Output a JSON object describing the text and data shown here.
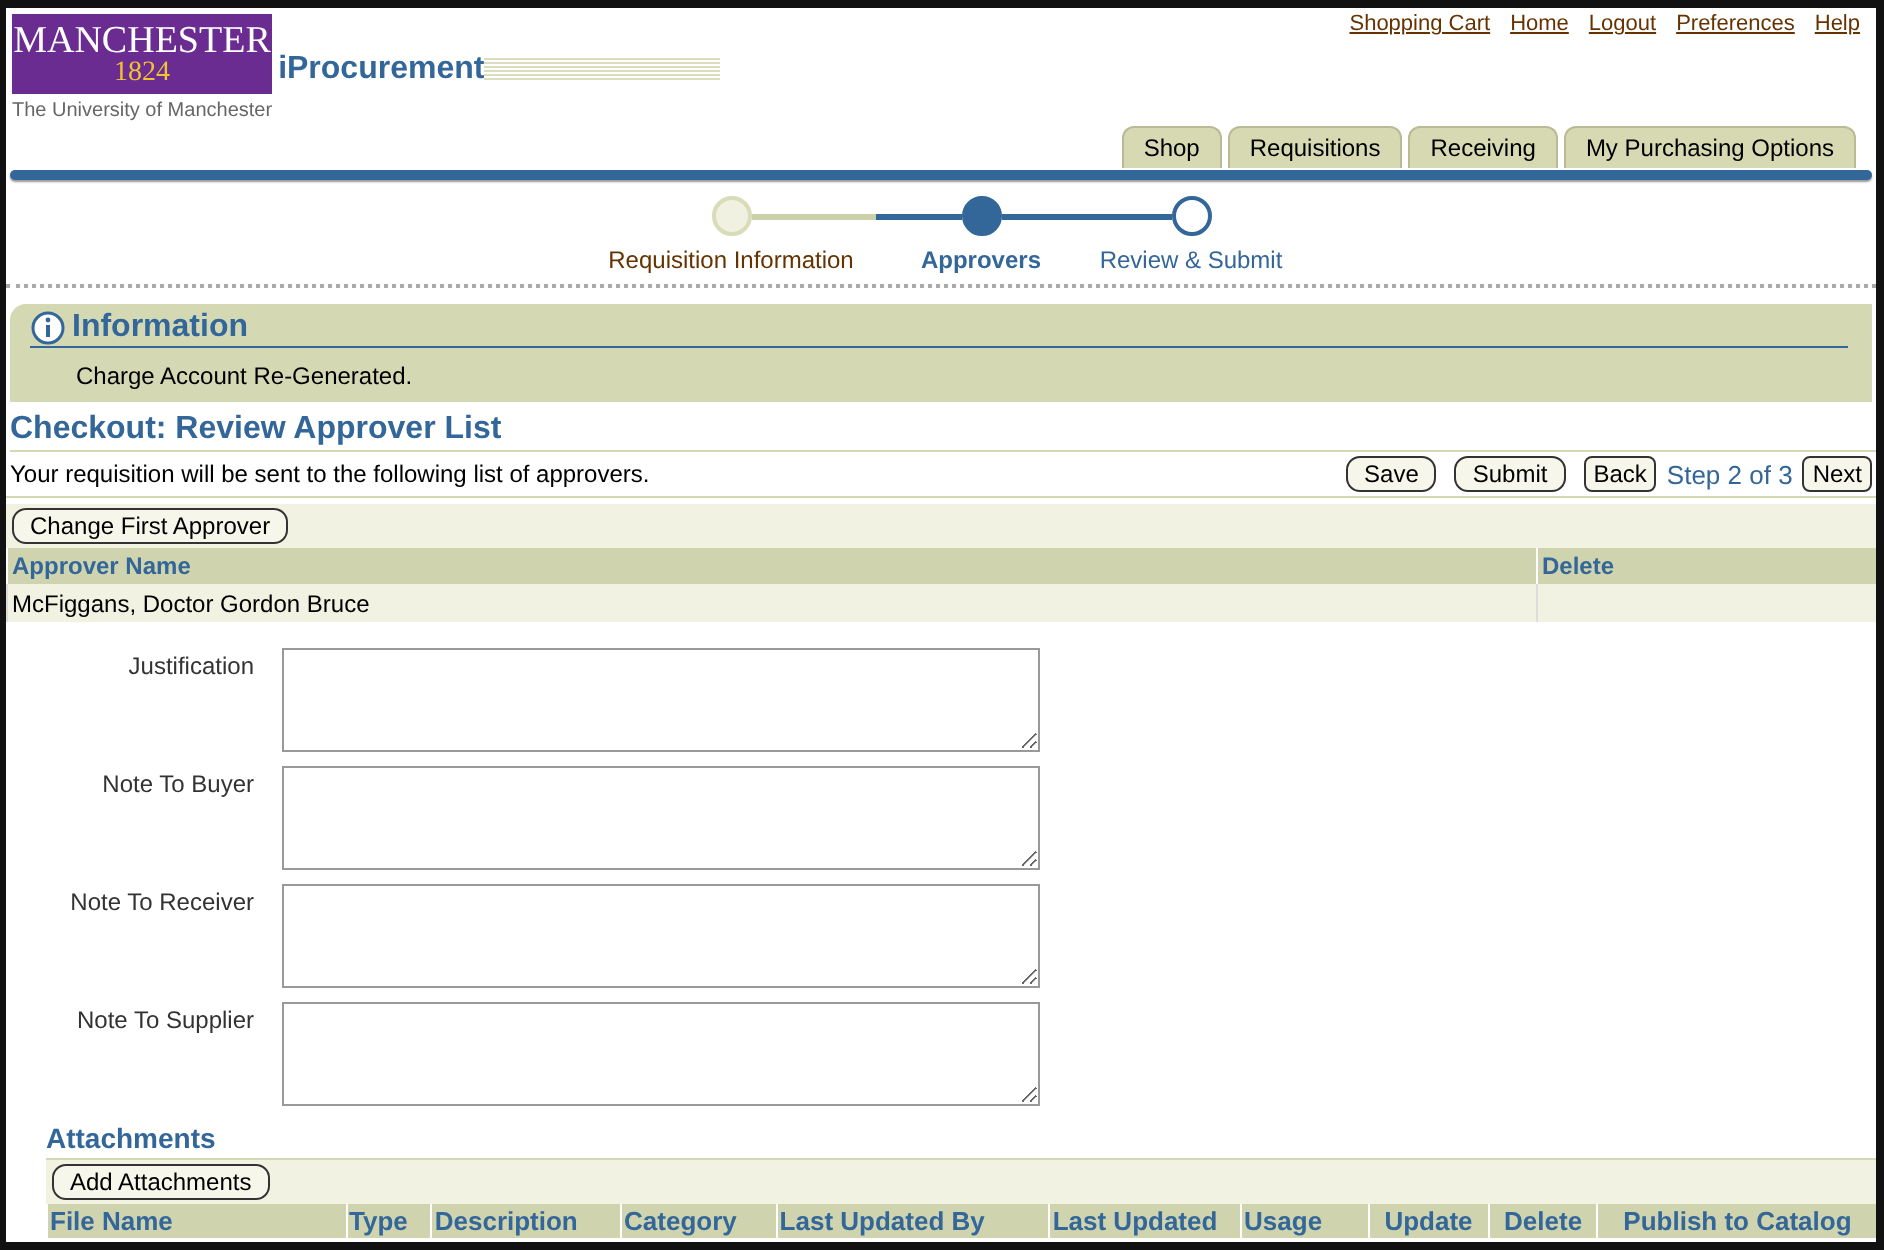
{
  "logo": {
    "name": "MANCHESTER",
    "year": "1824",
    "subtitle": "The University of Manchester"
  },
  "app_title": "iProcurement",
  "global_links": [
    "Shopping Cart",
    "Home",
    "Logout",
    "Preferences",
    "Help"
  ],
  "tabs": [
    {
      "label": "Shop",
      "selected": false
    },
    {
      "label": "Requisitions",
      "selected": false
    },
    {
      "label": "Receiving",
      "selected": false
    },
    {
      "label": "My Purchasing Options",
      "selected": false
    }
  ],
  "train": [
    {
      "label": "Requisition Information",
      "kind": "visited"
    },
    {
      "label": "Approvers",
      "kind": "current"
    },
    {
      "label": "Review & Submit",
      "kind": "future"
    }
  ],
  "message": {
    "title": "Information",
    "text": "Charge Account Re-Generated."
  },
  "page_title": "Checkout: Review Approver List",
  "instruction": "Your requisition will be sent to the following list of approvers.",
  "actions": {
    "save": "Save",
    "submit": "Submit",
    "back": "Back",
    "step": "Step 2 of 3",
    "next": "Next"
  },
  "change_button": "Change First Approver",
  "approver_table": {
    "columns": [
      "Approver Name",
      "Delete"
    ],
    "rows": [
      [
        "McFiggans, Doctor Gordon Bruce",
        ""
      ]
    ]
  },
  "notes": [
    {
      "label": "Justification"
    },
    {
      "label": "Note To Buyer"
    },
    {
      "label": "Note To Receiver"
    },
    {
      "label": "Note To Supplier"
    }
  ],
  "attachments": {
    "title": "Attachments",
    "button": "Add Attachments",
    "columns": [
      "File Name",
      "Type",
      "Description",
      "Category",
      "Last Updated By",
      "Last Updated",
      "Usage",
      "Update",
      "Delete",
      "Publish to Catalog"
    ]
  }
}
